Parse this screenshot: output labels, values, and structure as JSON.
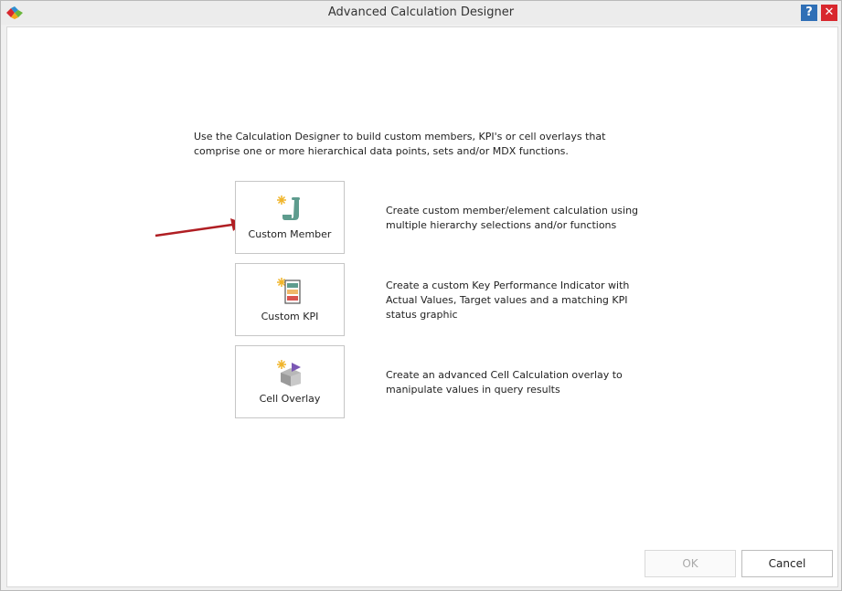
{
  "window": {
    "title": "Advanced Calculation Designer",
    "help_label": "?",
    "close_label": "✕"
  },
  "intro_text": "Use the Calculation Designer to build custom members, KPI's or cell overlays that comprise one or more hierarchical data points, sets and/or MDX functions.",
  "options": [
    {
      "label": "Custom Member",
      "description": "Create custom member/element calculation using multiple hierarchy selections and/or functions",
      "icon": "custom-member-icon"
    },
    {
      "label": "Custom KPI",
      "description": "Create a custom Key Performance Indicator with Actual Values, Target values and a matching KPI status graphic",
      "icon": "custom-kpi-icon"
    },
    {
      "label": "Cell Overlay",
      "description": "Create an advanced Cell Calculation overlay to manipulate values in query results",
      "icon": "cell-overlay-icon"
    }
  ],
  "footer": {
    "ok_label": "OK",
    "cancel_label": "Cancel",
    "ok_enabled": false
  },
  "colors": {
    "accent_arrow": "#b01e23",
    "help": "#2f6fb6",
    "close": "#d8272d"
  }
}
